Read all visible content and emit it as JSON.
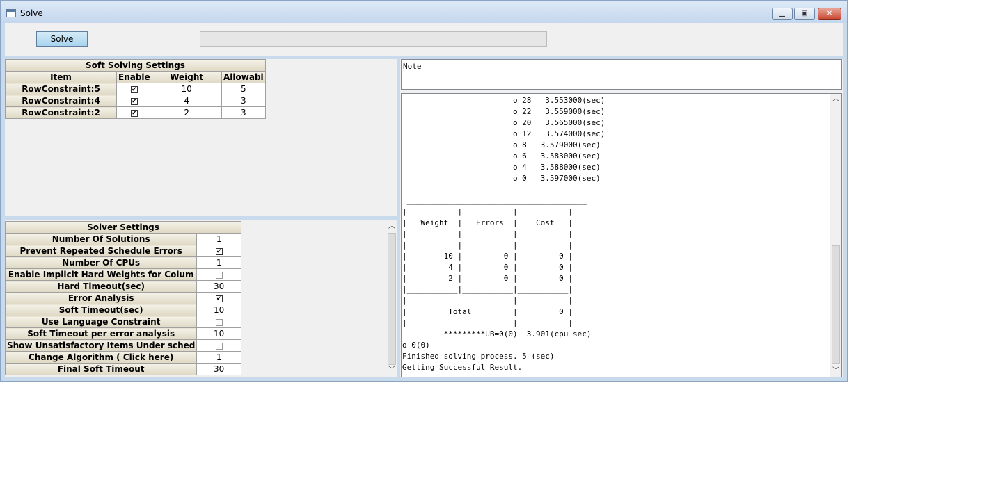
{
  "window": {
    "title": "Solve",
    "min_glyph": "▁",
    "max_glyph": "▣",
    "close_glyph": "✕"
  },
  "toolbar": {
    "solve_label": "Solve",
    "progress_percent": 0
  },
  "soft_settings": {
    "title": "Soft Solving Settings",
    "columns": [
      "Item",
      "Enable",
      "Weight",
      "Allowabl"
    ],
    "rows": [
      {
        "item": "RowConstraint:5",
        "enable": true,
        "weight": "10",
        "allowable": "5"
      },
      {
        "item": "RowConstraint:4",
        "enable": true,
        "weight": "4",
        "allowable": "3"
      },
      {
        "item": "RowConstraint:2",
        "enable": true,
        "weight": "2",
        "allowable": "3"
      }
    ]
  },
  "solver_settings": {
    "title": "Solver Settings",
    "rows": [
      {
        "label": "Number Of Solutions",
        "value": "1"
      },
      {
        "label": "Prevent Repeated Schedule Errors",
        "check": true
      },
      {
        "label": "Number Of CPUs",
        "value": "1"
      },
      {
        "label": "Enable Implicit Hard Weights for Colum",
        "check": false
      },
      {
        "label": "Hard Timeout(sec)",
        "value": "30"
      },
      {
        "label": "Error Analysis",
        "check": true
      },
      {
        "label": "Soft Timeout(sec)",
        "value": "10"
      },
      {
        "label": "Use Language Constraint",
        "check": false
      },
      {
        "label": "Soft Timeout per error analysis",
        "value": "10"
      },
      {
        "label": "Show Unsatisfactory Items Under sched",
        "check": false
      },
      {
        "label": "Change Algorithm ( Click here)",
        "value": "1"
      },
      {
        "label": "Final Soft Timeout",
        "value": "30"
      }
    ]
  },
  "note": {
    "label": "Note"
  },
  "log": {
    "lines": [
      "                        o 28   3.553000(sec)",
      "                        o 22   3.559000(sec)",
      "                        o 20   3.565000(sec)",
      "                        o 12   3.574000(sec)",
      "                        o 8   3.579000(sec)",
      "                        o 6   3.583000(sec)",
      "                        o 4   3.588000(sec)",
      "                        o 0   3.597000(sec)",
      "",
      " _______________________________________",
      "|           |           |           |",
      "|   Weight  |   Errors  |    Cost   |",
      "|___________|___________|___________|",
      "|           |           |           |",
      "|        10 |         0 |         0 |",
      "|         4 |         0 |         0 |",
      "|         2 |         0 |         0 |",
      "|___________|___________|___________|",
      "|                       |           |",
      "|         Total         |         0 |",
      "|_______________________|___________|",
      "         *********UB=0(0)  3.901(cpu sec)",
      "o 0(0)",
      "Finished solving process. 5 (sec)",
      "Getting Successful Result."
    ]
  }
}
